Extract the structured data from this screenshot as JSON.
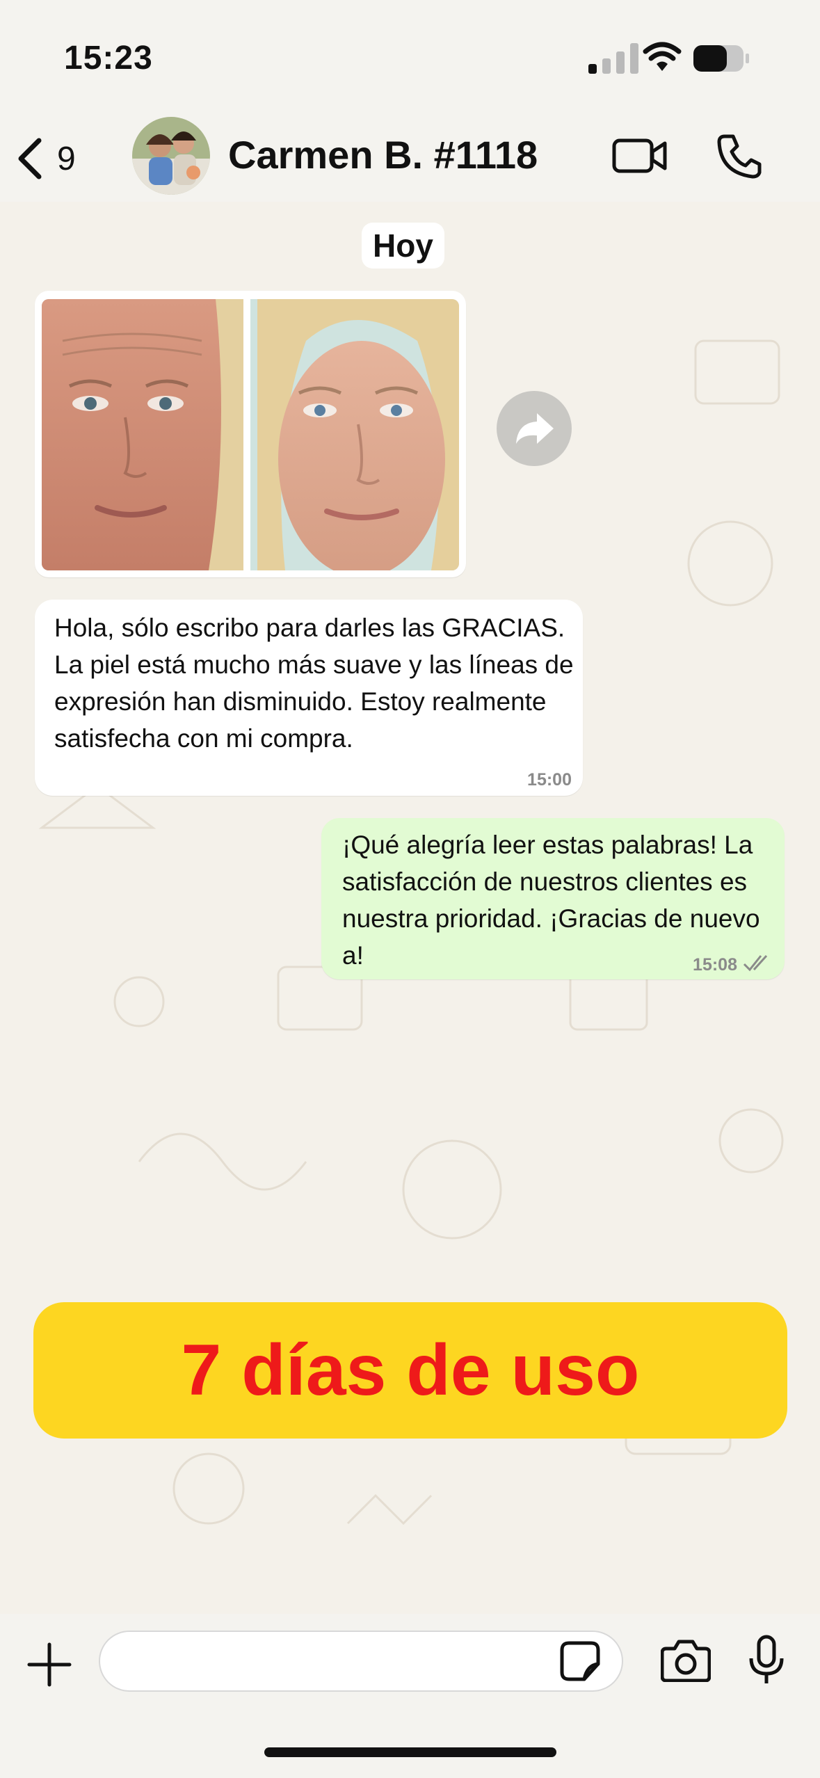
{
  "status_bar": {
    "time": "15:23"
  },
  "header": {
    "back_count": "9",
    "contact_name": "Carmen B. #1118"
  },
  "chat": {
    "date_label": "Hoy",
    "messages": [
      {
        "direction": "incoming",
        "text": "Hola, sólo escribo para darles las GRACIAS. La piel está mucho más suave y las líneas de expresión han disminuido. Estoy realmente satisfecha con mi compra.",
        "time": "15:00"
      },
      {
        "direction": "outgoing",
        "text": "¡Qué alegría leer estas palabras! La satisfacción de nuestros clientes es nuestra prioridad. ¡Gracias de nuevo a!",
        "time": "15:08",
        "status": "read"
      }
    ]
  },
  "banner": {
    "text": "7 días de uso",
    "background": "#fdd621",
    "color": "#ee1a1a"
  },
  "colors": {
    "outgoing_bubble": "#e2fbd3",
    "incoming_bubble": "#ffffff",
    "wallpaper": "#f4f1ea"
  }
}
